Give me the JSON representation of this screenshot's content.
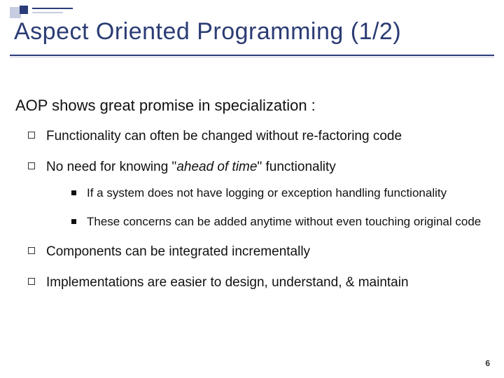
{
  "title": "Aspect Oriented Programming (1/2)",
  "intro": "AOP shows great promise in specialization :",
  "bullets": {
    "b1": "Functionality can often be changed without re-factoring code",
    "b2_pre": "No need for knowing \"",
    "b2_em": "ahead of time",
    "b2_post": "\" functionality",
    "b2_sub1": "If a system does not have logging or exception handling functionality",
    "b2_sub2": "These concerns can be added anytime without even touching original code",
    "b3": "Components can be integrated incrementally",
    "b4": "Implementations are easier to design, understand, & maintain"
  },
  "page_number": "6"
}
